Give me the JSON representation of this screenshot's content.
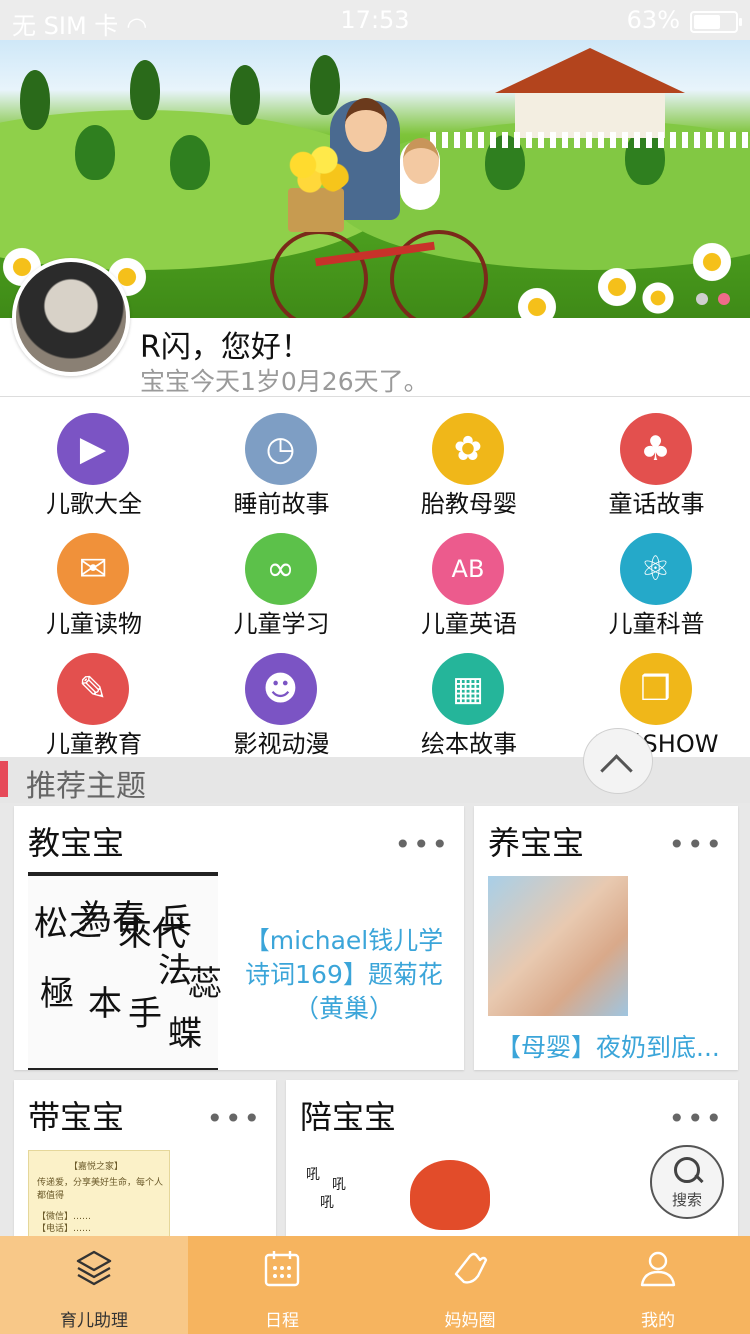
{
  "status_bar": {
    "carrier": "无 SIM 卡",
    "time": "17:53",
    "battery": "63%",
    "battery_level": 0.63
  },
  "banner": {
    "page_count": 2,
    "active_page": 2
  },
  "profile": {
    "greeting": "R闪，您好！",
    "age_text": "宝宝今天1岁0月26天了。"
  },
  "categories": [
    {
      "label": "儿歌大全",
      "icon": "video-icon",
      "color": "#7b54c4",
      "glyph": "▶"
    },
    {
      "label": "睡前故事",
      "icon": "clock-icon",
      "color": "#7e9ec4",
      "glyph": "◷"
    },
    {
      "label": "胎教母婴",
      "icon": "pacifier-icon",
      "color": "#f0b719",
      "glyph": "✿"
    },
    {
      "label": "童话故事",
      "icon": "tree-icon",
      "color": "#e3504e",
      "glyph": "♣"
    },
    {
      "label": "儿童读物",
      "icon": "chat-icon",
      "color": "#f0913a",
      "glyph": "✉"
    },
    {
      "label": "儿童学习",
      "icon": "glasses-icon",
      "color": "#5cc14a",
      "glyph": "∞"
    },
    {
      "label": "儿童英语",
      "icon": "abc-cube-icon",
      "color": "#ec5b8d",
      "glyph": "AB"
    },
    {
      "label": "儿童科普",
      "icon": "atom-icon",
      "color": "#25a9c9",
      "glyph": "⚛"
    },
    {
      "label": "儿童教育",
      "icon": "edit-note-icon",
      "color": "#e3504e",
      "glyph": "✎"
    },
    {
      "label": "影视动漫",
      "icon": "teddy-bear-icon",
      "color": "#7b54c4",
      "glyph": "☻"
    },
    {
      "label": "绘本故事",
      "icon": "image-icon",
      "color": "#25b59a",
      "glyph": "▦"
    },
    {
      "label": "宝贝SHOW",
      "icon": "photos-icon",
      "color": "#f0b719",
      "glyph": "❒"
    }
  ],
  "recommend": {
    "title": "推荐主题",
    "more": "•••",
    "cards": [
      {
        "title": "教宝宝",
        "caption": "【michael钱儿学诗词169】题菊花（黄巢）"
      },
      {
        "title": "养宝宝",
        "caption": "【母婴】夜奶到底..."
      },
      {
        "title": "带宝宝"
      },
      {
        "title": "陪宝宝"
      }
    ]
  },
  "search_fab": {
    "label": "搜索"
  },
  "tabs": [
    {
      "label": "育儿助理",
      "icon": "layers-icon"
    },
    {
      "label": "日程",
      "icon": "calendar-icon"
    },
    {
      "label": "妈妈圈",
      "icon": "hand-icon"
    },
    {
      "label": "我的",
      "icon": "user-icon"
    }
  ]
}
